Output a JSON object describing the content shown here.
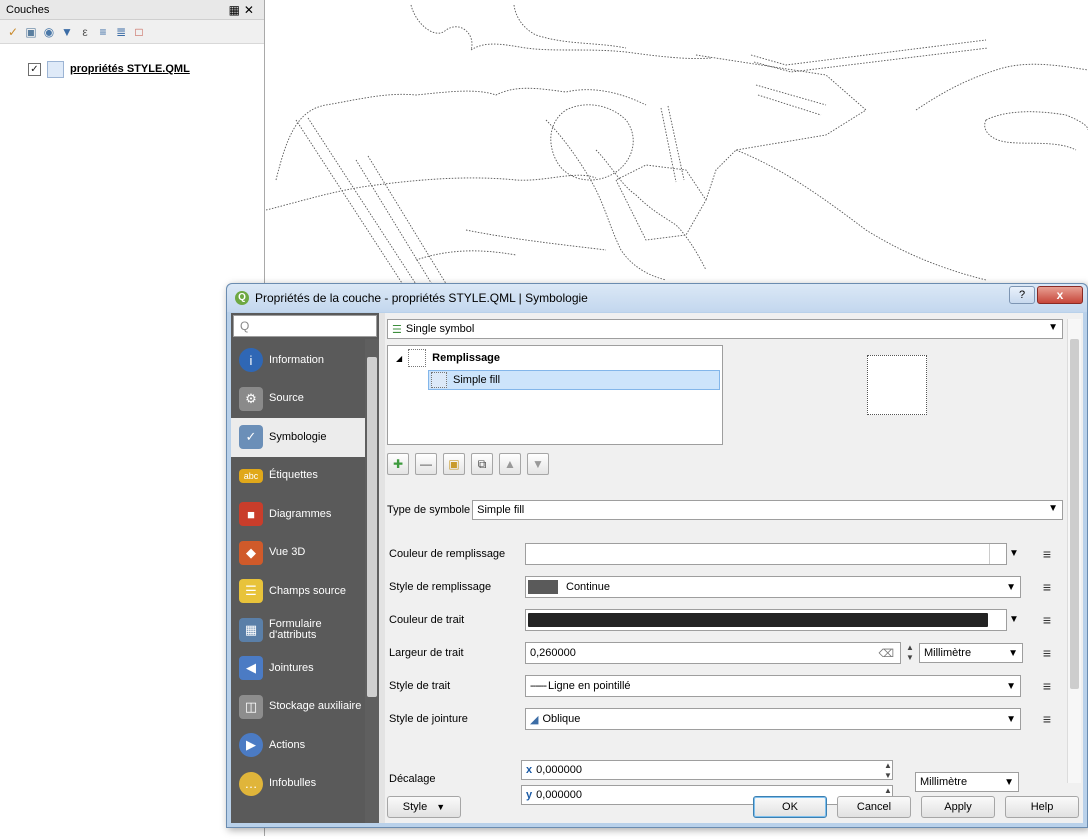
{
  "layers_panel": {
    "title": "Couches",
    "controls": "Ȱ ✕",
    "toolbar_icons": [
      "paint-brush-icon",
      "add-group-icon",
      "eye-icon",
      "filter-icon",
      "filter-expression-icon",
      "expand-all-icon",
      "collapse-all-icon",
      "remove-layer-icon"
    ],
    "layer": {
      "name": "propriétés STYLE.QML",
      "checked": true
    }
  },
  "dialog": {
    "logo": "Q",
    "title": "Propriétés de la couche - propriétés STYLE.QML | Symbologie",
    "help_btn": "?",
    "close_btn": "x",
    "sidebar": {
      "search_placeholder": "Q",
      "items": [
        {
          "label": "Information",
          "icon": "info-icon",
          "color": "#2f67b5"
        },
        {
          "label": "Source",
          "icon": "source-icon",
          "color": "#8a8a8a"
        },
        {
          "label": "Symbologie",
          "icon": "paintbrush-icon",
          "color": "#6b8fb8",
          "active": true
        },
        {
          "label": "Étiquettes",
          "icon": "abc-label-icon",
          "color": "#e0a81a"
        },
        {
          "label": "Diagrammes",
          "icon": "diagram-icon",
          "color": "#c93d2b"
        },
        {
          "label": "Vue 3D",
          "icon": "cube-3d-icon",
          "color": "#d05a2a"
        },
        {
          "label": "Champs source",
          "icon": "fields-icon",
          "color": "#e8c33a"
        },
        {
          "label": "Formulaire d'attributs",
          "icon": "form-icon",
          "color": "#5a7fa8"
        },
        {
          "label": "Jointures",
          "icon": "join-icon",
          "color": "#4b7bc4"
        },
        {
          "label": "Stockage auxiliaire",
          "icon": "storage-icon",
          "color": "#8d8d8d"
        },
        {
          "label": "Actions",
          "icon": "actions-icon",
          "color": "#4b7bc4"
        },
        {
          "label": "Infobulles",
          "icon": "tooltip-icon",
          "color": "#e0b53a"
        }
      ]
    },
    "renderer": {
      "label": "Single symbol",
      "icon": "single-symbol-icon"
    },
    "symbol_tree": {
      "root": "Remplissage",
      "child": "Simple fill"
    },
    "symbol_tools": [
      "add-layer-icon",
      "remove-layer-icon",
      "lock-icon",
      "duplicate-icon",
      "move-up-icon",
      "move-down-icon"
    ],
    "symbol_type": {
      "label": "Type de symbole",
      "value": "Simple fill"
    },
    "properties": {
      "fill_color": {
        "label": "Couleur de remplissage",
        "color": "#ffffff"
      },
      "fill_style": {
        "label": "Style de remplissage",
        "value": "Continue",
        "swatch": "#5a5a5a"
      },
      "stroke_color": {
        "label": "Couleur de trait",
        "color": "#232323"
      },
      "stroke_width": {
        "label": "Largeur de trait",
        "value": "0,260000",
        "unit": "Millimètre"
      },
      "stroke_style": {
        "label": "Style de trait",
        "value": "Ligne en pointillé",
        "preview": "------"
      },
      "join_style": {
        "label": "Style de jointure",
        "value": "Oblique"
      },
      "offset": {
        "label": "Décalage",
        "x_label": "x",
        "x": "0,000000",
        "y_label": "y",
        "y": "0,000000",
        "unit": "Millimètre"
      }
    },
    "footer": {
      "style_btn": "Style",
      "ok": "OK",
      "cancel": "Cancel",
      "apply": "Apply",
      "help": "Help"
    }
  },
  "colors": {
    "selection": "#cde4fb",
    "sidebar_bg": "#5a5a5a",
    "window_frame": "#b9d1ea"
  }
}
